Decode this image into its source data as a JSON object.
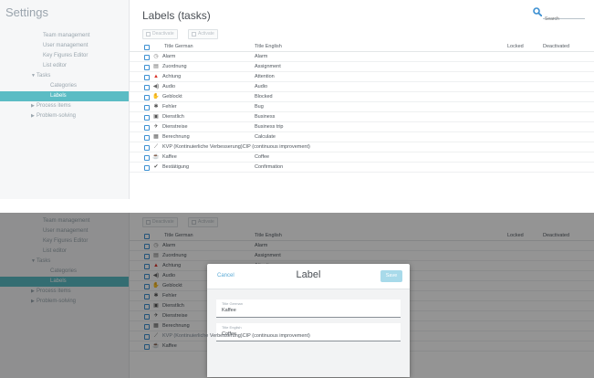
{
  "app_title": "Settings",
  "page_title": "Labels (tasks)",
  "search": {
    "placeholder": "Search"
  },
  "toolbar": {
    "deactivate_label": "Deactivate",
    "activate_label": "Activate"
  },
  "sidebar": {
    "items": [
      {
        "label": "Team management"
      },
      {
        "label": "User management"
      },
      {
        "label": "Key Figures Editor"
      },
      {
        "label": "List editor"
      },
      {
        "label": "Tasks",
        "arrow": "▼"
      },
      {
        "label": "Categories"
      },
      {
        "label": "Labels"
      },
      {
        "label": "Process items",
        "arrow": "▶"
      },
      {
        "label": "Problem-solving",
        "arrow": "▶"
      }
    ]
  },
  "table": {
    "headers": {
      "german": "Title German",
      "english": "Title English",
      "locked": "Locked",
      "deactivated": "Deactivated"
    },
    "rows": [
      {
        "de": "Alarm",
        "en": "Alarm",
        "icon": "alarm-clock-icon",
        "glyph": "◷",
        "color": "#777777"
      },
      {
        "de": "Zuordnung",
        "en": "Assignment",
        "icon": "clipboard-icon",
        "glyph": "▤",
        "color": "#666666"
      },
      {
        "de": "Achtung",
        "en": "Attention",
        "icon": "warning-icon",
        "glyph": "▲",
        "color": "#d9342b"
      },
      {
        "de": "Audio",
        "en": "Audio",
        "icon": "speaker-icon",
        "glyph": "◀)",
        "color": "#666666"
      },
      {
        "de": "Geblockt",
        "en": "Blocked",
        "icon": "stop-hand-icon",
        "glyph": "✋",
        "color": "#d9342b"
      },
      {
        "de": "Fehler",
        "en": "Bug",
        "icon": "bug-icon",
        "glyph": "✱",
        "color": "#555555"
      },
      {
        "de": "Dienstlich",
        "en": "Business",
        "icon": "briefcase-icon",
        "glyph": "▣",
        "color": "#555555"
      },
      {
        "de": "Dienstreise",
        "en": "Business trip",
        "icon": "airplane-icon",
        "glyph": "✈",
        "color": "#555555"
      },
      {
        "de": "Berechnung",
        "en": "Calculate",
        "icon": "calculator-icon",
        "glyph": "▦",
        "color": "#555555"
      },
      {
        "de": "KVP (Kontinuierliche Verbesserung)",
        "en": "CIP (continuous improvement)",
        "icon": "trend-line-icon",
        "glyph": "⟋",
        "color": "#555555",
        "joined": true
      },
      {
        "de": "Kaffee",
        "en": "Coffee",
        "icon": "coffee-cup-icon",
        "glyph": "☕",
        "color": "#555555"
      },
      {
        "de": "Bestätigung",
        "en": "Confirmation",
        "icon": "thumbs-up-icon",
        "glyph": "✔",
        "color": "#555555"
      }
    ]
  },
  "dialog": {
    "title": "Label",
    "cancel_label": "Cancel",
    "save_label": "Save",
    "fields": [
      {
        "label": "Title German",
        "value": "Kaffee"
      },
      {
        "label": "Title English",
        "value": "Coffee"
      }
    ]
  },
  "colors": {
    "accent": "#5bbcc4",
    "link": "#5aaad6",
    "checkbox": "#3b8fd1",
    "danger": "#d9342b"
  }
}
